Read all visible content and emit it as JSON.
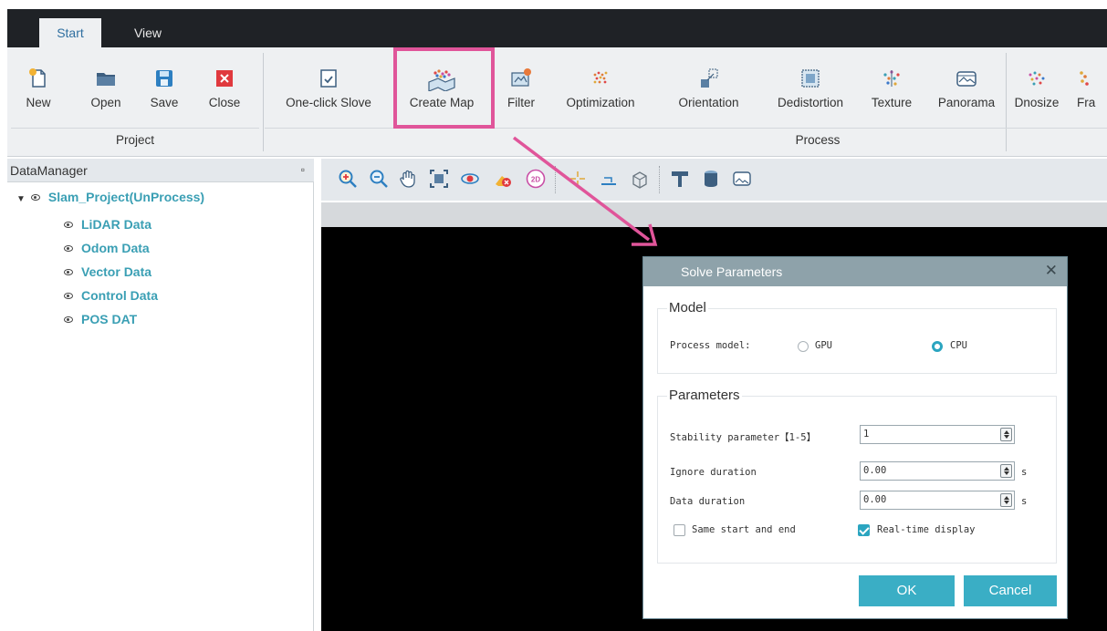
{
  "tabs": [
    {
      "label": "Start",
      "active": true
    },
    {
      "label": "View",
      "active": false
    }
  ],
  "ribbon": {
    "project": {
      "label": "Project",
      "buttons": [
        {
          "label": "New",
          "icon": "new-file-icon"
        },
        {
          "label": "Open",
          "icon": "folder-open-icon"
        },
        {
          "label": "Save",
          "icon": "save-icon"
        },
        {
          "label": "Close",
          "icon": "close-icon"
        }
      ]
    },
    "process": {
      "label": "Process",
      "buttons": [
        {
          "label": "One-click Slove",
          "icon": "one-click-icon"
        },
        {
          "label": "Create Map",
          "icon": "create-map-icon"
        },
        {
          "label": "Filter",
          "icon": "filter-icon"
        },
        {
          "label": "Optimization",
          "icon": "optimization-icon"
        },
        {
          "label": "Orientation",
          "icon": "orientation-icon"
        },
        {
          "label": "Dedistortion",
          "icon": "dedistortion-icon"
        },
        {
          "label": "Texture",
          "icon": "texture-icon"
        },
        {
          "label": "Panorama",
          "icon": "panorama-icon"
        },
        {
          "label": "Dnosize",
          "icon": "denoise-icon"
        },
        {
          "label": "Fra",
          "icon": "fragment-icon"
        }
      ]
    }
  },
  "data_manager": {
    "title": "DataManager",
    "root": "Slam_Project(UnProcess)",
    "items": [
      "LiDAR Data",
      "Odom Data",
      "Vector Data",
      "Control Data",
      "POS DAT"
    ]
  },
  "map_toolbar_icons": [
    "zoom-in-icon",
    "zoom-out-icon",
    "pan-hand-icon",
    "fit-extent-icon",
    "rotate-icon",
    "clear-icon",
    "view-2d-icon",
    "point-pick-icon",
    "measure-icon",
    "box-3d-icon",
    "profile-icon",
    "cylinder-icon",
    "panorama-view-icon"
  ],
  "dialog": {
    "title": "Solve Parameters",
    "model": {
      "title": "Model",
      "label": "Process model:",
      "options": [
        "GPU",
        "CPU"
      ],
      "selected": "CPU"
    },
    "parameters": {
      "title": "Parameters",
      "stability": {
        "label": "Stability parameter【1-5】",
        "value": "1"
      },
      "ignore": {
        "label": "Ignore duration",
        "value": "0.00",
        "unit": "s"
      },
      "data": {
        "label": "Data duration",
        "value": "0.00",
        "unit": "s"
      },
      "same_start_end": {
        "label": "Same start and end",
        "checked": false
      },
      "realtime": {
        "label": "Real-time display",
        "checked": true
      }
    },
    "ok_label": "OK",
    "cancel_label": "Cancel"
  },
  "colors": {
    "accent": "#2ba5c0",
    "highlight": "#e0559a",
    "tree_text": "#3a9fb4",
    "dialog_title_bar": "#8ea2aa"
  }
}
